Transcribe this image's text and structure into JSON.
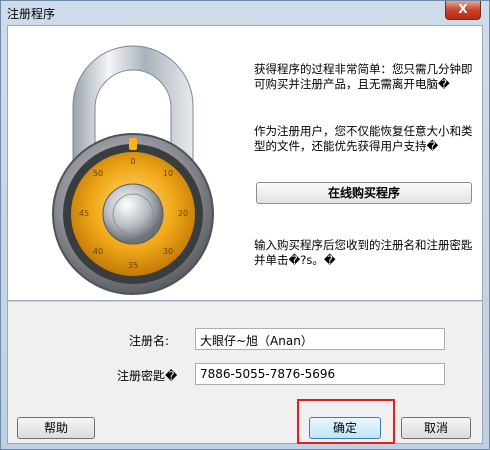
{
  "window": {
    "title": "注册程序",
    "close_label": "X"
  },
  "info": {
    "para1": "获得程序的过程非常简单：您只需几分钟即可购买并注册产品，且无需离开电脑�",
    "para2": "作为注册用户，您不仅能恢复任意大小和类型的文件，还能优先获得用户支持�",
    "buy_button": "在线购买程序",
    "para3": "输入购买程序后您收到的注册名和注册密匙并单击�?s。�"
  },
  "form": {
    "name_label": "注册名:",
    "name_value": "大眼仔~旭（Anan）",
    "key_label": "注册密匙�",
    "key_value": "7886-5055-7876-5696"
  },
  "buttons": {
    "help": "帮助",
    "ok": "确定",
    "cancel": "取消"
  },
  "colors": {
    "highlight": "#e02020",
    "dial": "#f0a818"
  }
}
